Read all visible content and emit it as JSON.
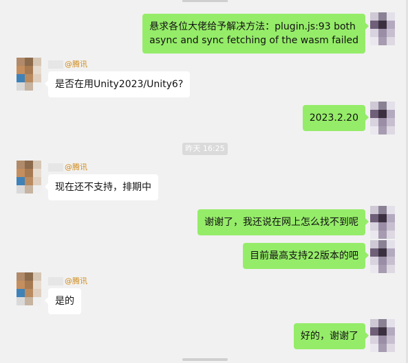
{
  "colors": {
    "background": "#f1f1f1",
    "incoming_bubble": "#ffffff",
    "outgoing_bubble": "#95ec69",
    "sender_name": "#d08a1a",
    "timestamp_bg": "#dadada"
  },
  "messages": [
    {
      "direction": "out",
      "text": "悬求各位大佬给予解决方法：plugin.js:93 both",
      "text2": "async and sync fetching of the wasm failed"
    },
    {
      "direction": "in",
      "sender": "@腾讯",
      "text": "是否在用Unity2023/Unity6?"
    },
    {
      "direction": "out",
      "text": "2023.2.20"
    },
    {
      "direction": "in",
      "sender": "@腾讯",
      "text": "现在还不支持，排期中"
    },
    {
      "direction": "out",
      "text": "谢谢了，我还说在网上怎么找不到呢"
    },
    {
      "direction": "out",
      "text": "目前最高支持22版本的吧"
    },
    {
      "direction": "in",
      "sender": "@腾讯",
      "text": "是的"
    },
    {
      "direction": "out",
      "text": "好的，谢谢了"
    }
  ],
  "timestamp": "昨天 16:25"
}
